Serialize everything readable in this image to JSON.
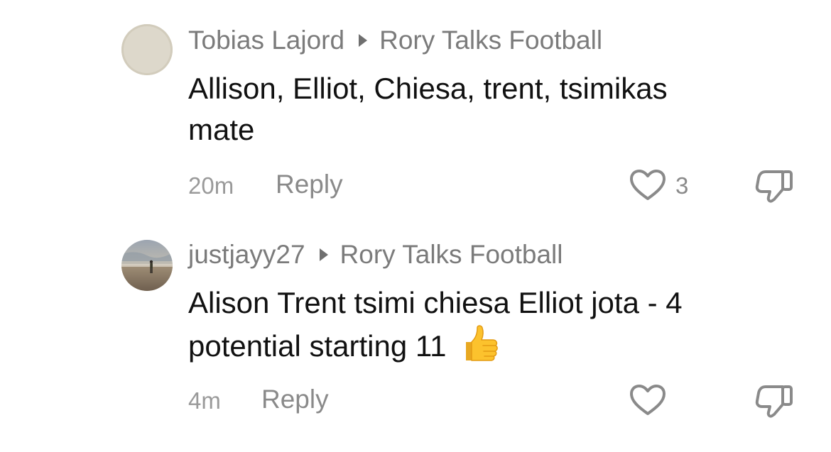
{
  "comments": [
    {
      "author": "Tobias Lajord",
      "reply_to": "Rory Talks Football",
      "text_line1": "Allison, Elliot, Chiesa, trent, tsimikas",
      "text_line2": "mate",
      "time": "20m",
      "reply_label": "Reply",
      "like_count": "3",
      "avatar": "plain-beige"
    },
    {
      "author": "justjayy27",
      "reply_to": "Rory Talks Football",
      "text_line1": "Alison Trent tsimi chiesa Elliot jota - 4",
      "text_line2": "potential starting 11",
      "emoji": "thumbs-up",
      "time": "4m",
      "reply_label": "Reply",
      "like_count": "",
      "avatar": "beach-photo"
    }
  ],
  "icons": {
    "like": "heart-outline-icon",
    "dislike": "thumbs-down-outline-icon",
    "separator": "caret-right-icon"
  },
  "colors": {
    "author": "#7b7b7b",
    "body": "#111111",
    "meta": "#9a9a9a",
    "icon": "#8a8a8a",
    "avatar_plain": "#ddd8cb"
  }
}
